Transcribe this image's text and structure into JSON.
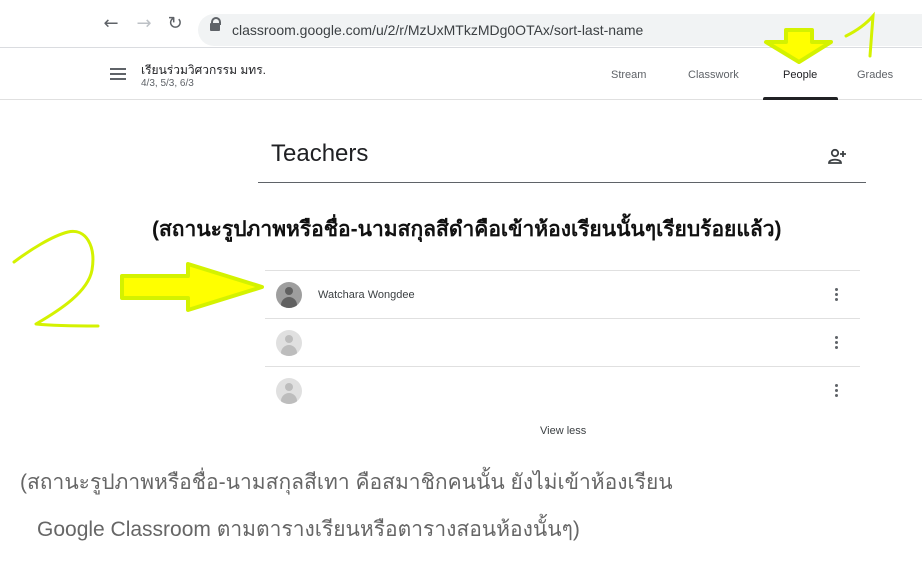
{
  "browser": {
    "url": "classroom.google.com/u/2/r/MzUxMTkzMDg0OTAx/sort-last-name",
    "back_icon": "arrow-left-icon",
    "forward_icon": "arrow-right-icon",
    "reload_icon": "reload-icon"
  },
  "header": {
    "class_name": "เรียนร่วมวิศวกรรม มทร.",
    "class_section": "4/3, 5/3, 6/3",
    "tabs": [
      {
        "label": "Stream"
      },
      {
        "label": "Classwork"
      },
      {
        "label": "People",
        "active": true
      },
      {
        "label": "Grades"
      }
    ]
  },
  "teachers": {
    "title": "Teachers",
    "members": [
      {
        "name": "Watchara Wongdee",
        "active": true
      },
      {
        "name": "",
        "active": false
      },
      {
        "name": "",
        "active": false
      }
    ],
    "view_less": "View less"
  },
  "annotations": {
    "main_note": "(สถานะรูปภาพหรือชื่อ-นามสกุลสีดำคือเข้าห้องเรียนนั้นๆเรียบร้อยแล้ว)",
    "bottom_note_line1": "(สถานะรูปภาพหรือชื่อ-นามสกุลสีเทา คือสมาชิกคนนั้น ยังไม่เข้าห้องเรียน",
    "bottom_note_line2": "Google Classroom  ตามตารางเรียนหรือตารางสอนห้องนั้นๆ)",
    "marker_1": "1",
    "marker_2": "2",
    "highlight_color": "#d4f200",
    "arrow_fill_color": "#ffff00"
  }
}
